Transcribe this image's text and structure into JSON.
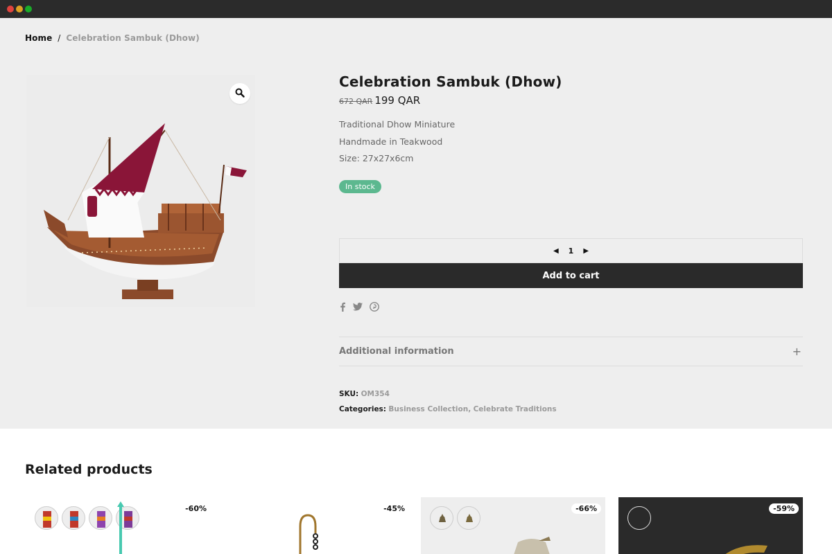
{
  "breadcrumb": {
    "home": "Home",
    "separator": "/",
    "current": "Celebration Sambuk (Dhow)"
  },
  "gallery": {
    "zoom_icon": "magnifier-icon"
  },
  "product": {
    "title": "Celebration Sambuk (Dhow)",
    "price_old": "672 QAR",
    "price_new": "199 QAR",
    "description": [
      "Traditional Dhow Miniature",
      "Handmade in Teakwood",
      "Size: 27x27x6cm"
    ],
    "stock": "In stock",
    "quantity": "1",
    "add_to_cart": "Add to cart",
    "share_icons": [
      "facebook-icon",
      "twitter-icon",
      "pinterest-icon"
    ],
    "additional_info": "Additional information",
    "sku_label": "SKU:",
    "sku": "OM354",
    "categories_label": "Categories:",
    "categories": [
      "Business Collection",
      "Celebrate Traditions"
    ],
    "category_sep": ","
  },
  "related": {
    "title": "Related products",
    "cards": [
      {
        "badge": "-60%"
      },
      {
        "badge": "-45%"
      },
      {
        "badge": "-66%"
      },
      {
        "badge": "-59%"
      }
    ]
  },
  "colors": {
    "accent_dark": "#2a2a2a",
    "stock_green": "#5cb88f",
    "background": "#eeeeee",
    "flag_maroon": "#8a1538"
  }
}
